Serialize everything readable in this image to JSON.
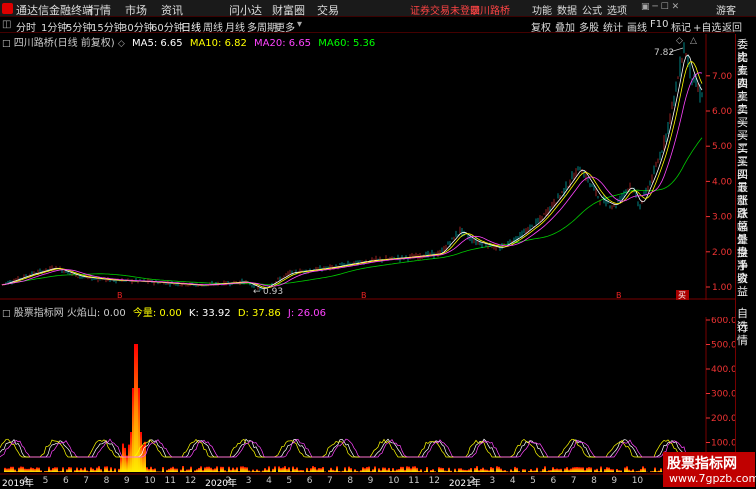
{
  "topbar": {
    "brand": "通达信金融终端",
    "menu": [
      "行情",
      "市场",
      "资讯",
      "问小达",
      "财富圈",
      "交易"
    ],
    "notice": "证券交易未登录",
    "stock_name": "四川路桥",
    "right": [
      "功能",
      "数据",
      "公式",
      "选项"
    ],
    "guest": "游客"
  },
  "toolbar": {
    "periods": [
      "分时",
      "1分钟",
      "5分钟",
      "15分钟",
      "30分钟",
      "60分钟",
      "日线",
      "周线",
      "月线",
      "多周期",
      "更多"
    ],
    "selected": "日线",
    "right_buttons": [
      "复权",
      "叠加",
      "多股",
      "统计",
      "画线",
      "F10",
      "标记",
      "+自选",
      "返回"
    ]
  },
  "main_chart": {
    "title": "四川路桥(日线 前复权)",
    "ma": [
      {
        "label": "MA5: 6.65",
        "color": "#ffffff"
      },
      {
        "label": "MA10: 6.82",
        "color": "#ffff00"
      },
      {
        "label": "MA20: 6.65",
        "color": "#ff44ff"
      },
      {
        "label": "MA60: 5.36",
        "color": "#00ff00"
      }
    ],
    "y_ticks": [
      "7.00",
      "6.00",
      "5.00",
      "4.00",
      "3.00",
      "2.00",
      "1.00"
    ],
    "high_label": "7.82",
    "low_label": "0.93",
    "markers": [
      "B",
      "B",
      "B",
      "买"
    ]
  },
  "indicator": {
    "title": "股票指标网 火焰山: 0.00 ",
    "vars": [
      {
        "label": "今量: 0.00",
        "color": "#ffff00"
      },
      {
        "label": "K: 33.92",
        "color": "#ffffff"
      },
      {
        "label": "D: 37.86",
        "color": "#ffff00"
      },
      {
        "label": "J: 26.06",
        "color": "#ff44ff"
      }
    ],
    "y_ticks": [
      "600.0",
      "500.0",
      "400.0",
      "300.0",
      "200.0",
      "100.0"
    ]
  },
  "right_panel": [
    "委比",
    "卖五",
    "卖四",
    "卖三",
    "卖二",
    "卖一",
    "买一",
    "买二",
    "买三",
    "买四",
    "买五",
    "最新",
    "涨跌",
    "涨幅",
    "总量",
    "外盘",
    "换手",
    "净资",
    "收益"
  ],
  "right_panel_bottom": [
    "自选",
    "行情"
  ],
  "date_axis": [
    "2019年",
    "4",
    "5",
    "6",
    "7",
    "8",
    "9",
    "10",
    "11",
    "12",
    "2020年",
    "2",
    "3",
    "4",
    "5",
    "6",
    "7",
    "8",
    "9",
    "10",
    "11",
    "12",
    "2021年",
    "2",
    "3",
    "4",
    "5",
    "6",
    "7",
    "8",
    "9",
    "10"
  ],
  "watermark": {
    "line1": "股票指标网",
    "line2": "www.7gpzb.com"
  }
}
